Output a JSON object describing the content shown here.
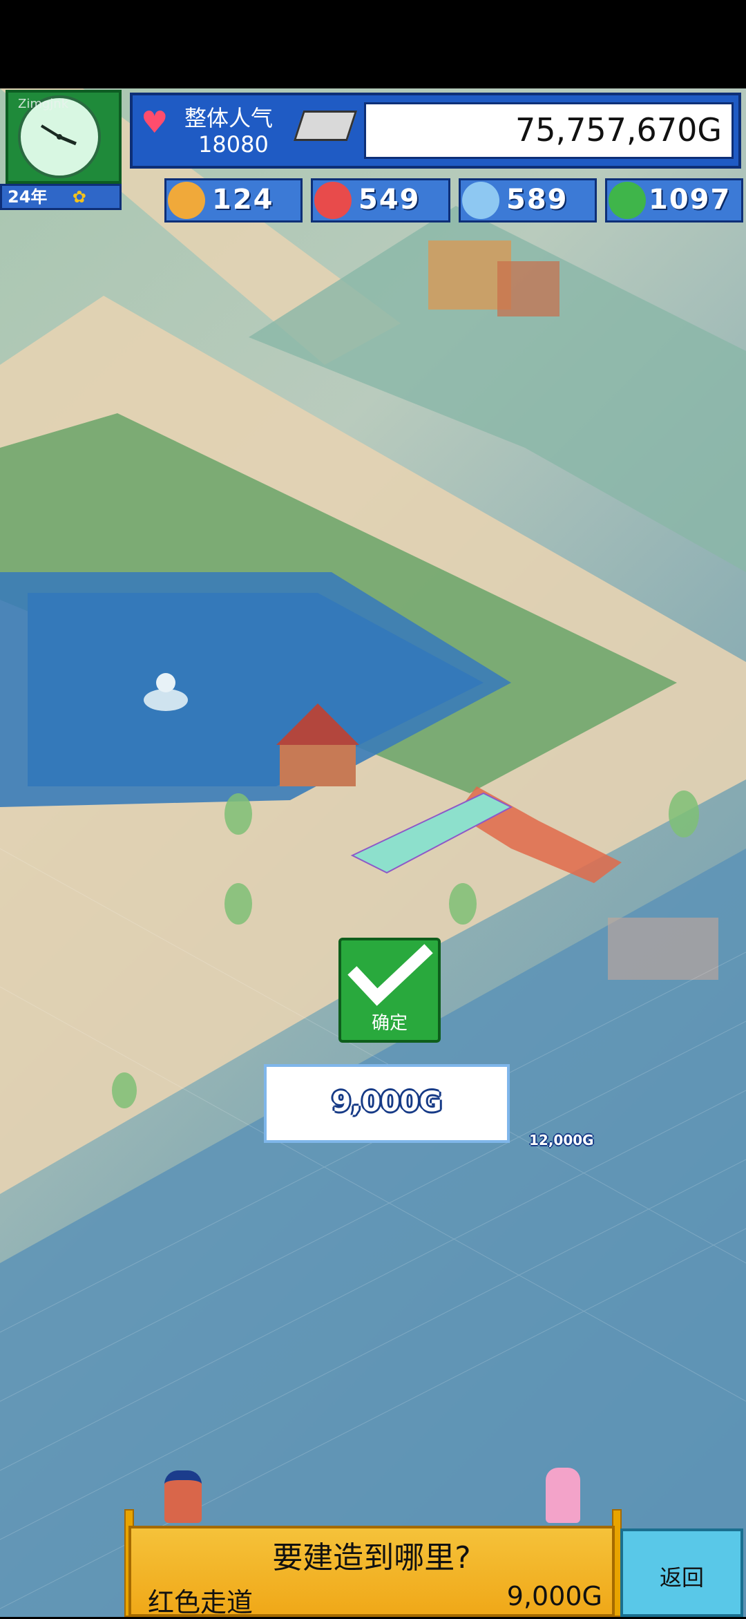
{
  "clock_tag": "Zimgjnk",
  "year": "24年",
  "popularity": {
    "label": "整体人气",
    "value": "18080"
  },
  "money": "75,757,670G",
  "stats": [
    {
      "icon": "food-icon",
      "value": "124",
      "color": "#f0a93a"
    },
    {
      "icon": "fire-icon",
      "value": "549",
      "color": "#e84b4b"
    },
    {
      "icon": "water-icon",
      "value": "589",
      "color": "#8ec8f2"
    },
    {
      "icon": "leaf-icon",
      "value": "1097",
      "color": "#3fb54a"
    }
  ],
  "map_price": "12,000G",
  "confirm": {
    "label": "确定"
  },
  "placement_price": "9,000G",
  "bottom": {
    "question": "要建造到哪里?",
    "item_name": "红色走道",
    "item_cost": "9,000G"
  },
  "back": {
    "label": "返回"
  }
}
